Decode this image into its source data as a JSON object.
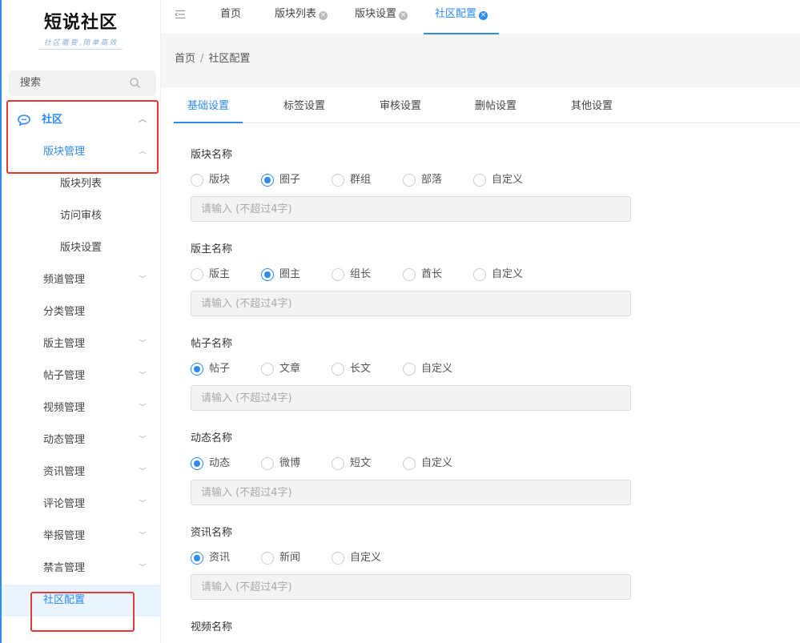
{
  "logo": {
    "title": "短说社区",
    "subtitle": "社区需要,简单高效"
  },
  "search": {
    "placeholder": "搜索"
  },
  "sidebar": {
    "community": "社区",
    "board_mgmt": "版块管理",
    "board_list": "版块列表",
    "access_review": "访问审核",
    "board_settings": "版块设置",
    "items": [
      "频道管理",
      "分类管理",
      "版主管理",
      "帖子管理",
      "视频管理",
      "动态管理",
      "资讯管理",
      "评论管理",
      "举报管理",
      "禁言管理"
    ],
    "community_config": "社区配置"
  },
  "tabs": [
    "首页",
    "版块列表",
    "版块设置",
    "社区配置"
  ],
  "breadcrumb": {
    "home": "首页",
    "sep": "/",
    "current": "社区配置"
  },
  "subtabs": [
    "基础设置",
    "标签设置",
    "审核设置",
    "删帖设置",
    "其他设置"
  ],
  "form": {
    "placeholder": "请输入 (不超过4字)",
    "sections": [
      {
        "title": "版块名称",
        "options": [
          "版块",
          "圈子",
          "群组",
          "部落",
          "自定义"
        ],
        "selected": 1
      },
      {
        "title": "版主名称",
        "options": [
          "版主",
          "圈主",
          "组长",
          "酋长",
          "自定义"
        ],
        "selected": 1
      },
      {
        "title": "帖子名称",
        "options": [
          "帖子",
          "文章",
          "长文",
          "自定义"
        ],
        "selected": 0
      },
      {
        "title": "动态名称",
        "options": [
          "动态",
          "微博",
          "短文",
          "自定义"
        ],
        "selected": 0
      },
      {
        "title": "资讯名称",
        "options": [
          "资讯",
          "新闻",
          "自定义"
        ],
        "selected": 0
      },
      {
        "title": "视频名称"
      }
    ]
  },
  "colors": {
    "accent": "#2d8cf0",
    "highlight": "#e53935"
  }
}
